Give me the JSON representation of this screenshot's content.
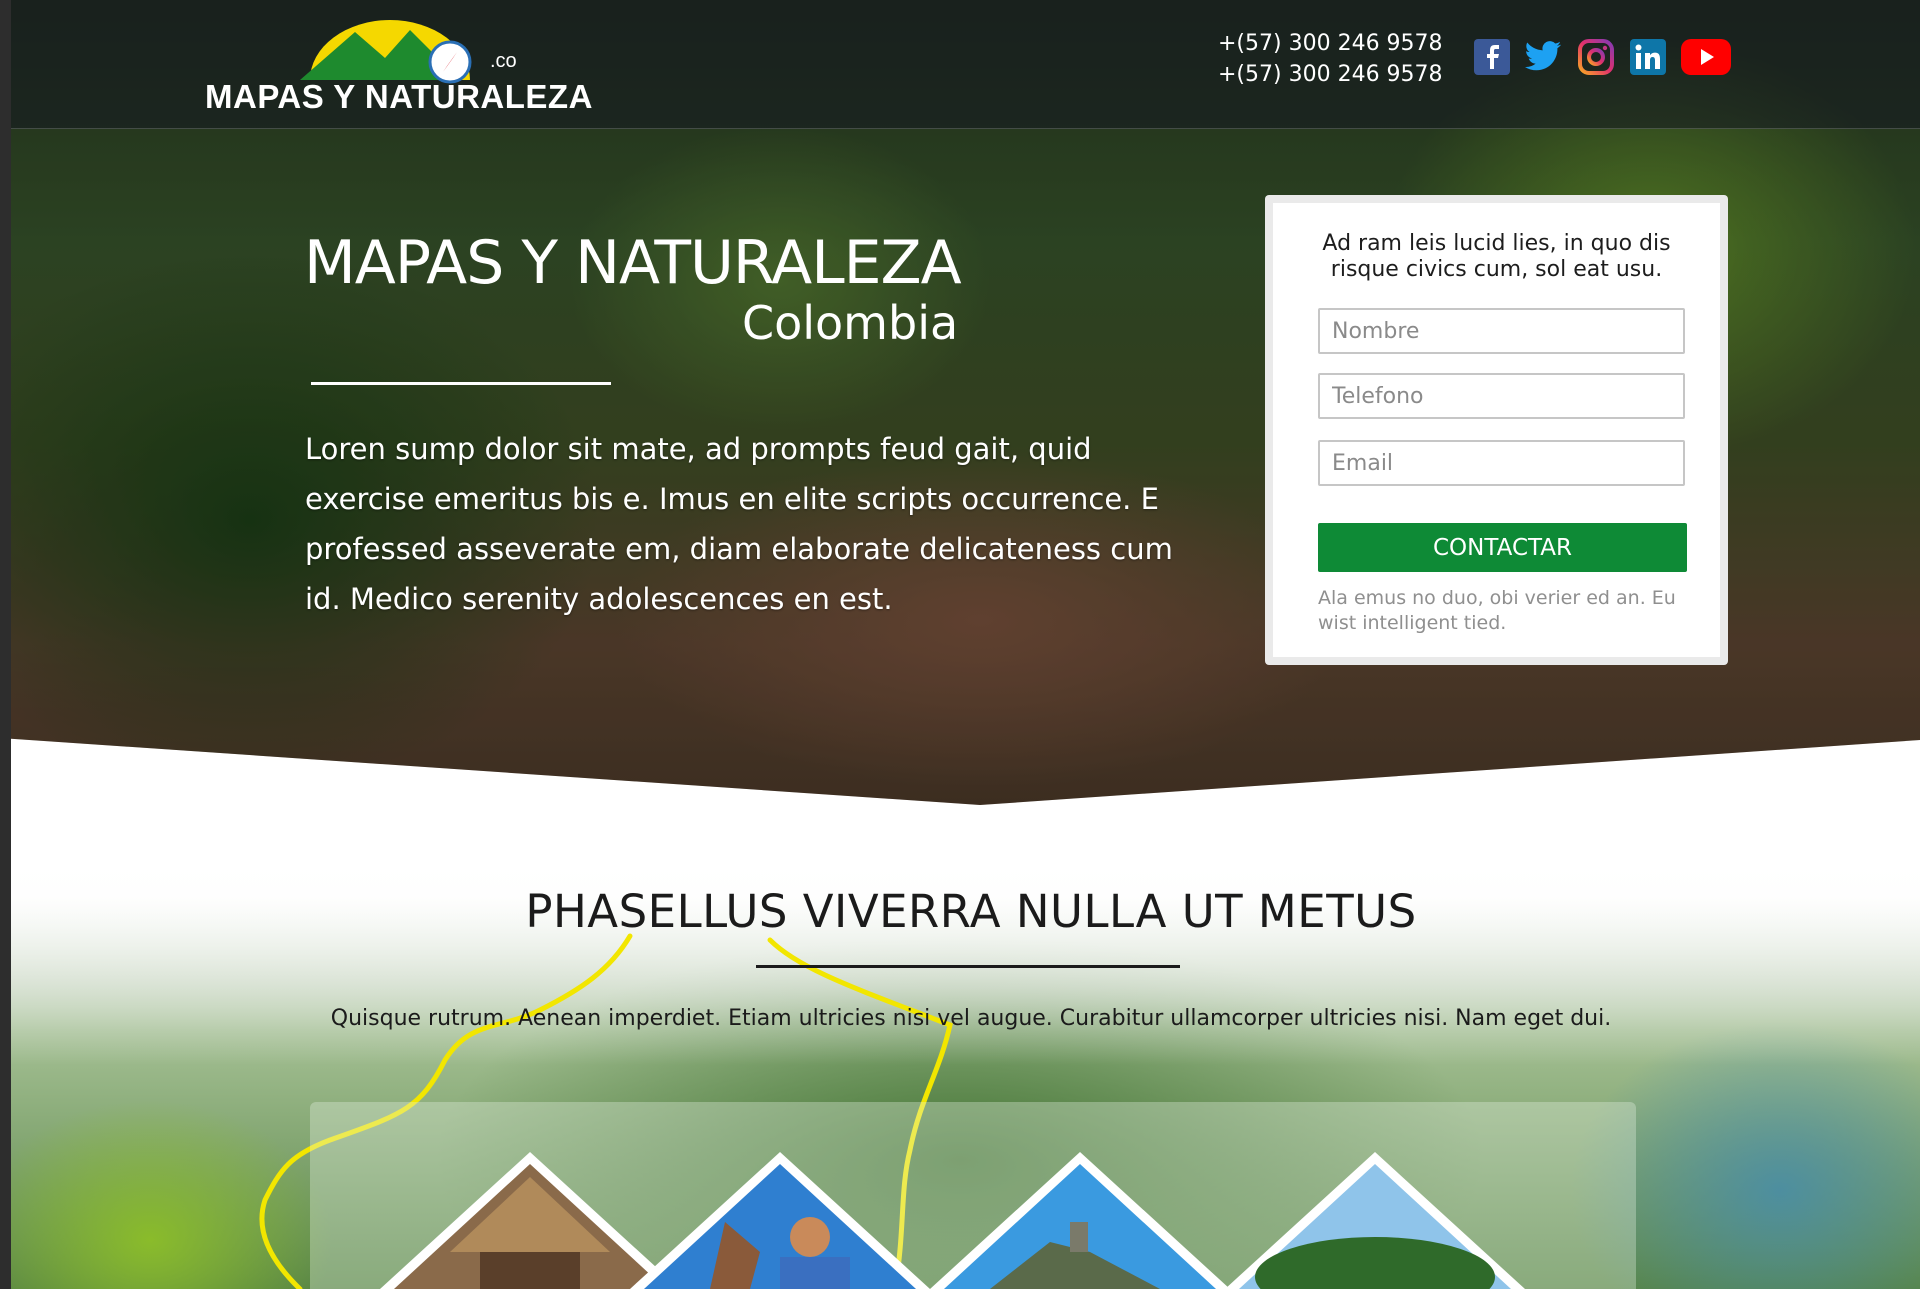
{
  "header": {
    "logo_text": "MAPAS Y NATURALEZA",
    "logo_tld": ".co",
    "phones": [
      "+(57) 300 246 9578",
      "+(57) 300 246 9578"
    ],
    "social_icons": [
      "facebook-icon",
      "twitter-icon",
      "instagram-icon",
      "linkedin-icon",
      "youtube-icon"
    ]
  },
  "hero": {
    "title": "MAPAS Y NATURALEZA",
    "subtitle": "Colombia",
    "body": "Loren sump dolor sit mate, ad prompts feud gait, quid exercise emeritus bis e. Imus en elite scripts occurrence. E professed asseverate em, diam elaborate delicateness cum id. Medico serenity adolescences en est."
  },
  "form": {
    "intro": "Ad ram leis lucid lies, in quo dis risque civics cum, sol eat usu.",
    "name_placeholder": "Nombre",
    "phone_placeholder": "Telefono",
    "email_placeholder": "Email",
    "submit_label": "CONTACTAR",
    "note": "Ala emus no duo, obi verier ed an. Eu wist intelligent tied."
  },
  "section": {
    "title": "PHASELLUS VIVERRA NULLA UT METUS",
    "body": "Quisque rutrum. Aenean imperdiet. Etiam ultricies nisi vel augue. Curabitur ullamcorper ultricies nisi. Nam eget dui."
  },
  "colors": {
    "accent_green": "#0e8a36",
    "logo_yellow": "#f5d800",
    "route_yellow": "#f2e600",
    "facebook": "#3b5998",
    "twitter": "#1da1f2",
    "instagram": "#e1306c",
    "linkedin": "#0e76a8",
    "youtube": "#ff0000"
  }
}
